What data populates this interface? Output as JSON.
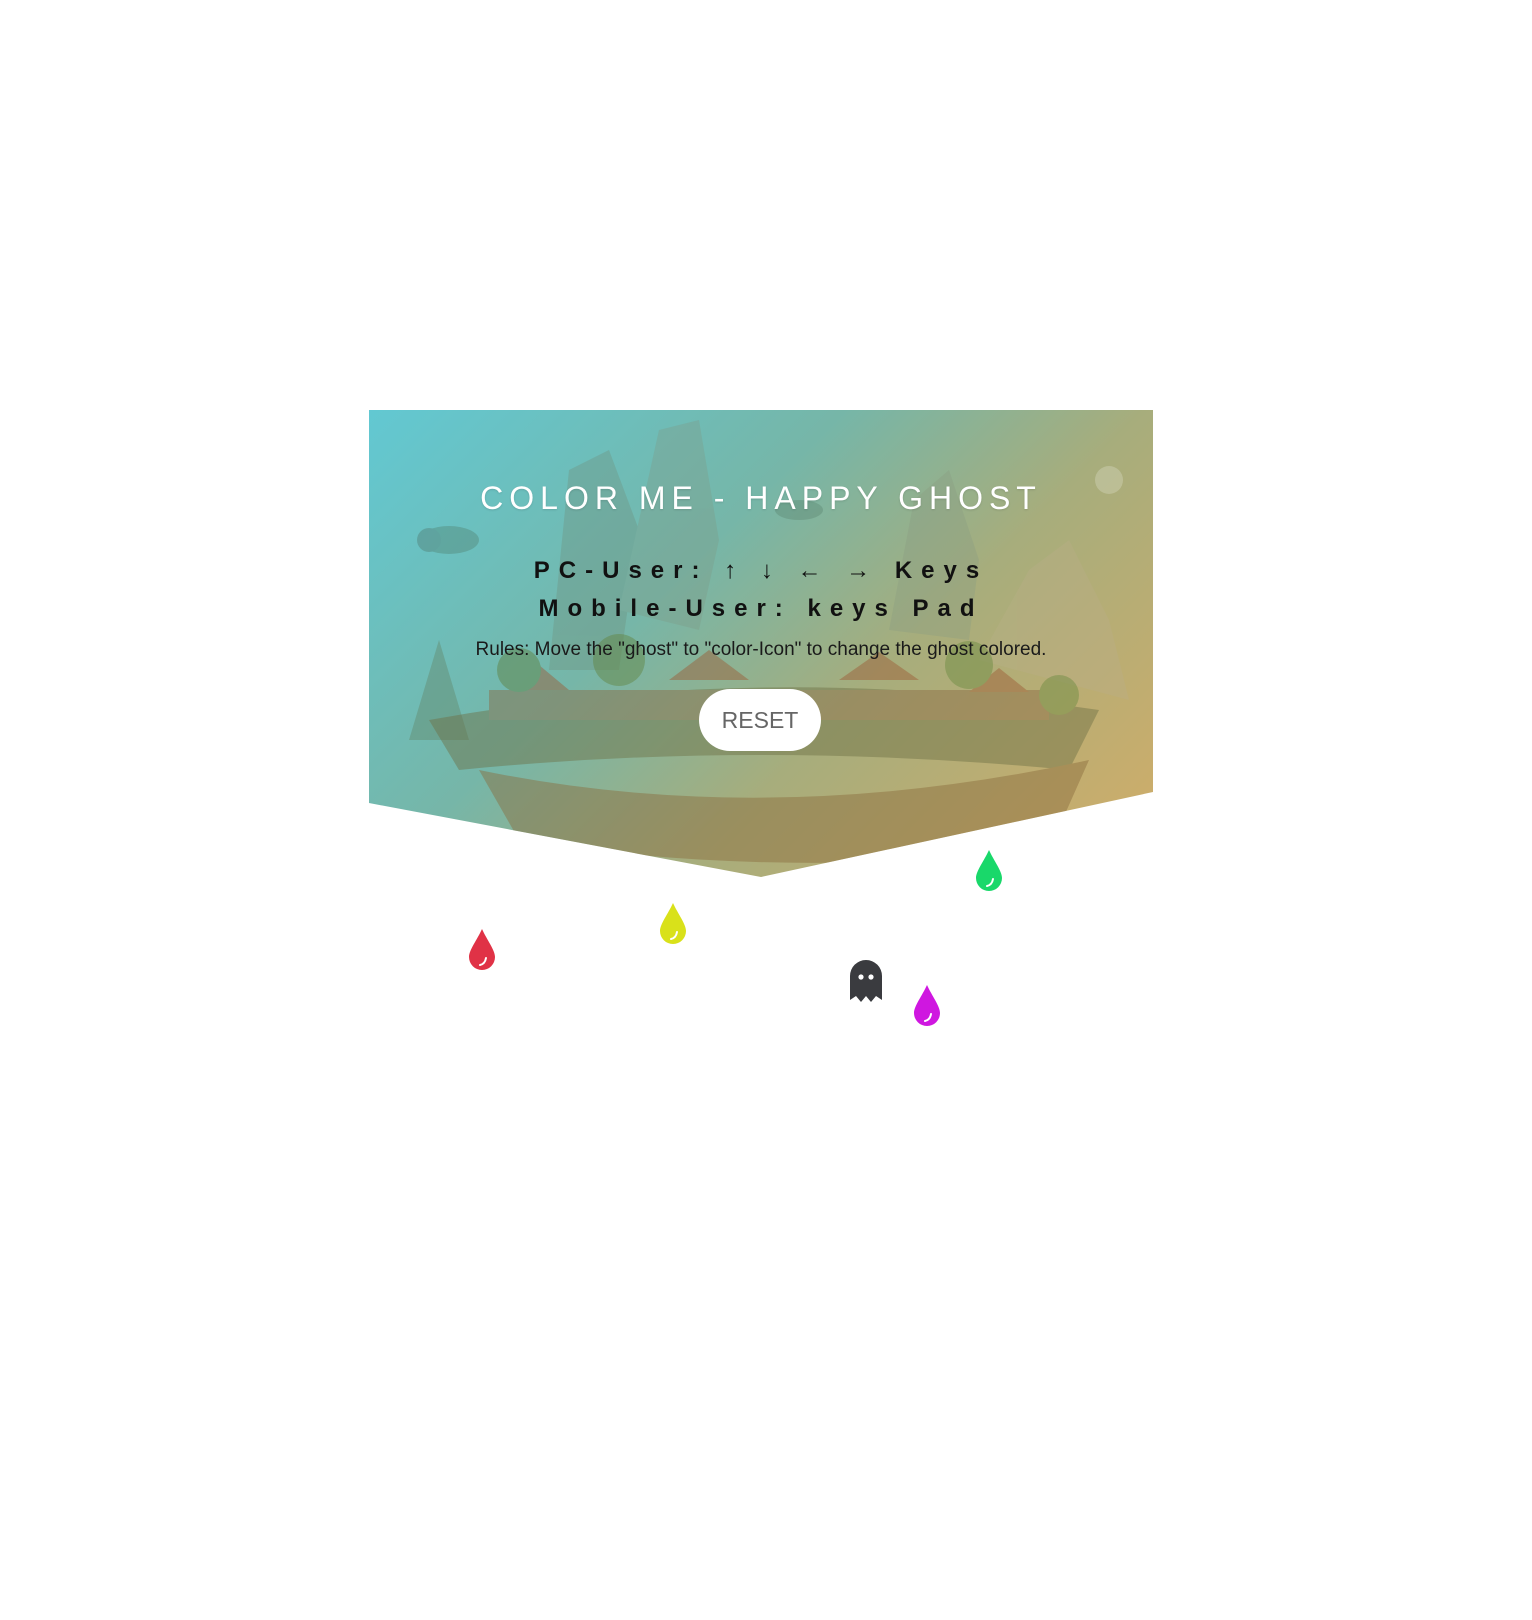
{
  "game": {
    "title": "COLOR ME - HAPPY GHOST",
    "pc_controls": "PC-User: ↑ ↓ ← → Keys",
    "mobile_controls": "Mobile-User: keys Pad",
    "rules": "Rules: Move the \"ghost\" to \"color-Icon\" to change the ghost colored.",
    "reset_label": "RESET"
  },
  "ghost": {
    "icon": "ghost-icon",
    "color": "#3a3b3f"
  },
  "color_drops": [
    {
      "name": "red-drop-icon",
      "color": "#e03246"
    },
    {
      "name": "yellow-drop-icon",
      "color": "#d9e11a"
    },
    {
      "name": "green-drop-icon",
      "color": "#19d86a"
    },
    {
      "name": "magenta-drop-icon",
      "color": "#cf17e0"
    }
  ]
}
